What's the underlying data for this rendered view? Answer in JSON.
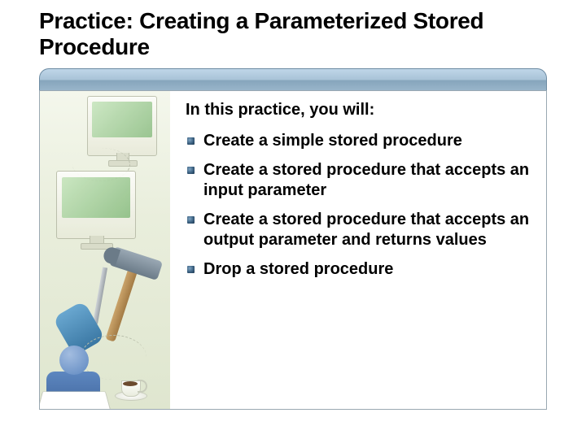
{
  "title": "Practice: Creating a Parameterized Stored Procedure",
  "lead": "In this practice, you will:",
  "bullets": [
    "Create a simple stored procedure",
    "Create a stored procedure that accepts an input parameter",
    "Create a stored procedure that accepts an output parameter and returns values",
    "Drop a stored procedure"
  ]
}
